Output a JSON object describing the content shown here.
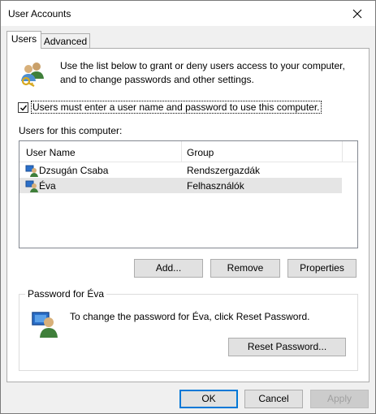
{
  "window": {
    "title": "User Accounts",
    "close_glyph": "✕"
  },
  "tabs": [
    {
      "label": "Users",
      "active": true
    },
    {
      "label": "Advanced",
      "active": false
    }
  ],
  "users_tab": {
    "intro_icon": "users-key-icon",
    "intro_text": "Use the list below to grant or deny users access to your computer, and to change passwords and other settings.",
    "require_login": {
      "checked": true,
      "label": "Users must enter a user name and password to use this computer."
    },
    "users_list_label": "Users for this computer:",
    "table": {
      "columns": [
        "User Name",
        "Group"
      ],
      "rows": [
        {
          "name": "Dzsugán Csaba",
          "group": "Rendszergazdák",
          "icon": "user-icon",
          "selected": false
        },
        {
          "name": "Éva",
          "group": "Felhasználók",
          "icon": "user-icon",
          "selected": true
        }
      ]
    },
    "buttons": {
      "add": "Add...",
      "remove": "Remove",
      "properties": "Properties"
    },
    "password_group": {
      "label": "Password for Éva",
      "icon": "user-monitor-icon",
      "text": "To change the password for Éva, click Reset Password.",
      "reset_button": "Reset Password..."
    }
  },
  "footer": {
    "ok": "OK",
    "cancel": "Cancel",
    "apply": "Apply"
  },
  "colors": {
    "accent": "#0078d7",
    "selection": "#e5e5e5"
  }
}
